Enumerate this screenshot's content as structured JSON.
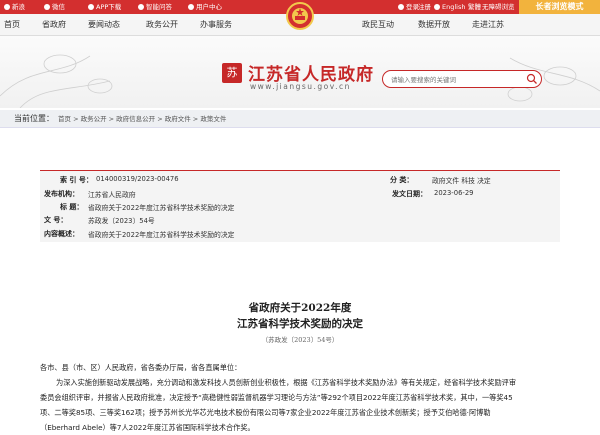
{
  "topbar": {
    "weibo": "新浪",
    "wechat": "微信",
    "app": "APP下载",
    "miniprogram": "智能问答",
    "usercenter": "用户中心",
    "login": "登录",
    "register": "注册",
    "english": "English",
    "traditional": "繁體",
    "accessibility": "无障碍浏览",
    "elder_mode": "长者浏览模式"
  },
  "nav": [
    "首页",
    "省政府",
    "要闻动态",
    "政务公开",
    "办事服务",
    "政民互动",
    "数据开放",
    "走进江苏"
  ],
  "banner": {
    "seal_text": "苏",
    "title": "江苏省人民政府",
    "url": "www.jiangsu.gov.cn",
    "search_placeholder": "请输入要搜索的关键词"
  },
  "breadcrumb": {
    "label": "当前位置：",
    "trail": "首页 > 政务公开 > 政府信息公开 > 政府文件 > 政策文件"
  },
  "meta": {
    "index_label": "索  引  号：",
    "index_value": "014000319/2023-00476",
    "category_label": "分    类：",
    "category_value": "政府文件 科技 决定",
    "issuer_label": "发布机构：",
    "issuer_value": "江苏省人民政府",
    "date_label": "发文日期：",
    "date_value": "2023-06-29",
    "title_label": "标    题：",
    "title_value": "省政府关于2022年度江苏省科学技术奖励的决定",
    "docno_label": "文    号：",
    "docno_value": "苏政发〔2023〕54号",
    "summary_label": "内容概述：",
    "summary_value": "省政府关于2022年度江苏省科学技术奖励的决定"
  },
  "doc": {
    "title_line1": "省政府关于2022年度",
    "title_line2": "江苏省科学技术奖励的决定",
    "number": "（苏政发〔2023〕54号）",
    "greeting": "各市、县（市、区）人民政府，省各委办厅局，省各直属单位：",
    "body_lines": [
      "为深入实施创新驱动发展战略，充分调动和激发科技人员创新创业积极性，根据《江苏省科学技术奖励办法》等有关规定，经省科学技术奖励评审",
      "委员会组织评审，并报省人民政府批准，决定授予“高稳健性弱监督机器学习理论与方法”等292个项目2022年度江苏省科学技术奖，其中，一等奖45",
      "项、二等奖85项、三等奖162项；授予苏州长光华芯光电技术股份有限公司等7家企业2022年度江苏省企业技术创新奖；授予艾伯哈德·阿博勒",
      "（Eberhard Abele）等7人2022年度江苏省国际科学技术合作奖。"
    ]
  },
  "colors": {
    "accent": "#c62828",
    "topbar": "#d32f2f",
    "elder": "#f2b33d"
  }
}
